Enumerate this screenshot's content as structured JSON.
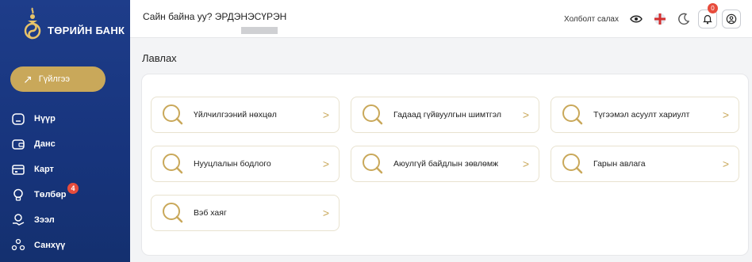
{
  "brand": {
    "name": "ТӨРИЙН БАНК"
  },
  "sidebar": {
    "transaction_label": "Гүйлгээ",
    "items": [
      {
        "label": "Нүүр",
        "icon": "home-icon"
      },
      {
        "label": "Данс",
        "icon": "wallet-icon"
      },
      {
        "label": "Карт",
        "icon": "card-icon"
      },
      {
        "label": "Төлбөр",
        "icon": "bulb-icon",
        "badge": "4"
      },
      {
        "label": "Зээл",
        "icon": "loan-icon"
      },
      {
        "label": "Санхүү",
        "icon": "finance-icon"
      }
    ]
  },
  "header": {
    "greeting": "Сайн байна уу? ЭРДЭНЭСҮРЭН",
    "connect_label": "Холболт салах",
    "notification_count": "0"
  },
  "page": {
    "title": "Лавлах",
    "cards": [
      {
        "label": "Үйлчилгээний нөхцөл"
      },
      {
        "label": "Гадаад гүйвуулгын шимтгэл"
      },
      {
        "label": "Түгээмэл асуулт хариулт"
      },
      {
        "label": "Нууцлалын бодлого"
      },
      {
        "label": "Аюулгүй байдлын зөвлөмж"
      },
      {
        "label": "Гарын авлага"
      },
      {
        "label": "Вэб хаяг"
      }
    ]
  },
  "colors": {
    "sidebar": "#1e3d8a",
    "accent": "#c9a85a",
    "badge": "#e74c3c"
  }
}
